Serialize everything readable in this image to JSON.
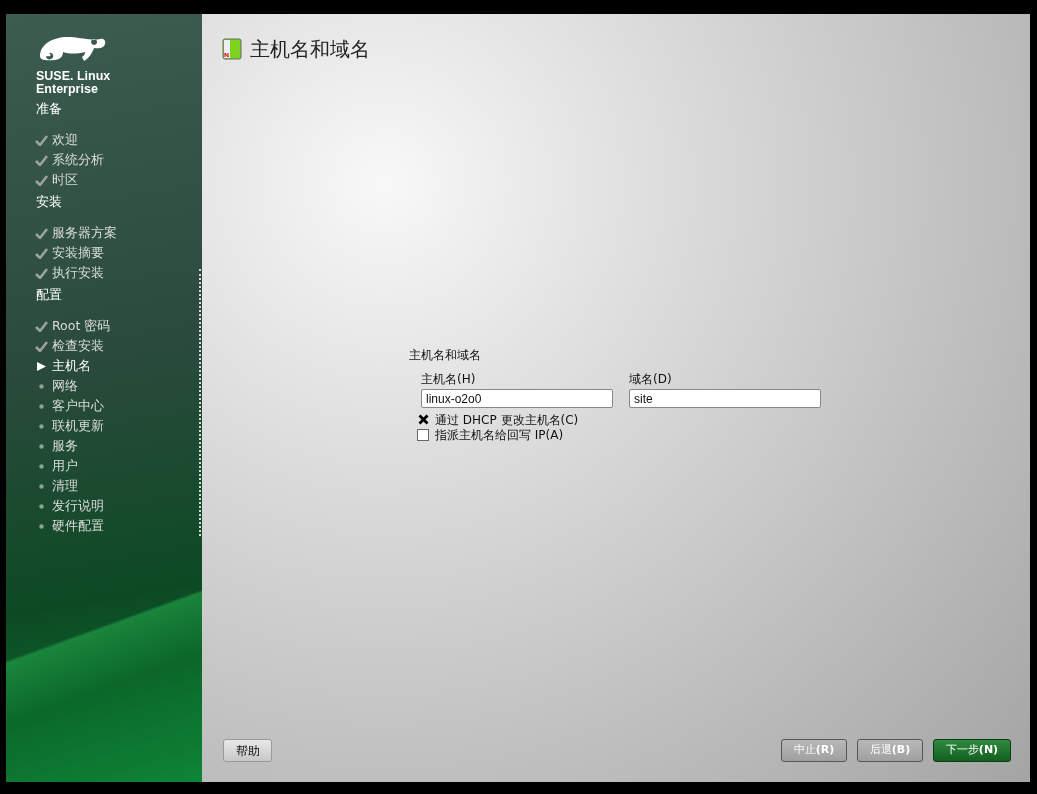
{
  "logo": {
    "line_1": "SUSE. Linux",
    "line_2": "Enterprise"
  },
  "sidebar": {
    "sections": [
      {
        "title": "准备",
        "items": [
          {
            "label": "欢迎",
            "kind": "done"
          },
          {
            "label": "系统分析",
            "kind": "done"
          },
          {
            "label": "时区",
            "kind": "done"
          }
        ]
      },
      {
        "title": "安装",
        "items": [
          {
            "label": "服务器方案",
            "kind": "done"
          },
          {
            "label": "安装摘要",
            "kind": "done"
          },
          {
            "label": "执行安装",
            "kind": "done"
          }
        ]
      },
      {
        "title": "配置",
        "items": [
          {
            "label": "Root 密码",
            "kind": "done"
          },
          {
            "label": "检查安装",
            "kind": "done"
          },
          {
            "label": "主机名",
            "kind": "current"
          },
          {
            "label": "网络",
            "kind": "pending"
          },
          {
            "label": "客户中心",
            "kind": "pending"
          },
          {
            "label": "联机更新",
            "kind": "pending"
          },
          {
            "label": "服务",
            "kind": "pending"
          },
          {
            "label": "用户",
            "kind": "pending"
          },
          {
            "label": "清理",
            "kind": "pending"
          },
          {
            "label": "发行说明",
            "kind": "pending"
          },
          {
            "label": "硬件配置",
            "kind": "pending"
          }
        ]
      }
    ]
  },
  "page": {
    "title": "主机名和域名",
    "group": {
      "title": "主机名和域名",
      "fields": [
        {
          "label": "主机名(H)",
          "value": "linux-o2o0"
        },
        {
          "label": "域名(D)",
          "value": "site"
        }
      ],
      "checkboxes": [
        {
          "label": "通过 DHCP 更改主机名(C)",
          "checked": true
        },
        {
          "label": "指派主机名给回写 IP(A)",
          "checked": false
        }
      ]
    }
  },
  "buttons": {
    "help": "帮助",
    "actions": [
      {
        "label": "中止**(R)**",
        "primary": false
      },
      {
        "label": "后退**(B)**",
        "primary": false
      },
      {
        "label": "下一步**(N)**",
        "primary": true
      }
    ]
  }
}
